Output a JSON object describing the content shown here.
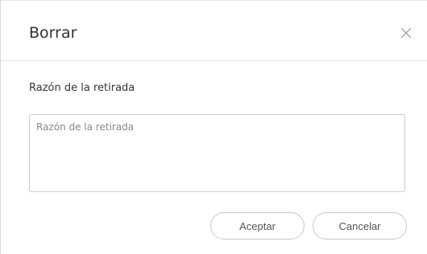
{
  "dialog": {
    "title": "Borrar",
    "close_icon": "close-icon"
  },
  "form": {
    "label": "Razón de la retirada",
    "reason_placeholder": "Razón de la retirada",
    "reason_value": ""
  },
  "buttons": {
    "accept_label": "Aceptar",
    "cancel_label": "Cancelar"
  }
}
